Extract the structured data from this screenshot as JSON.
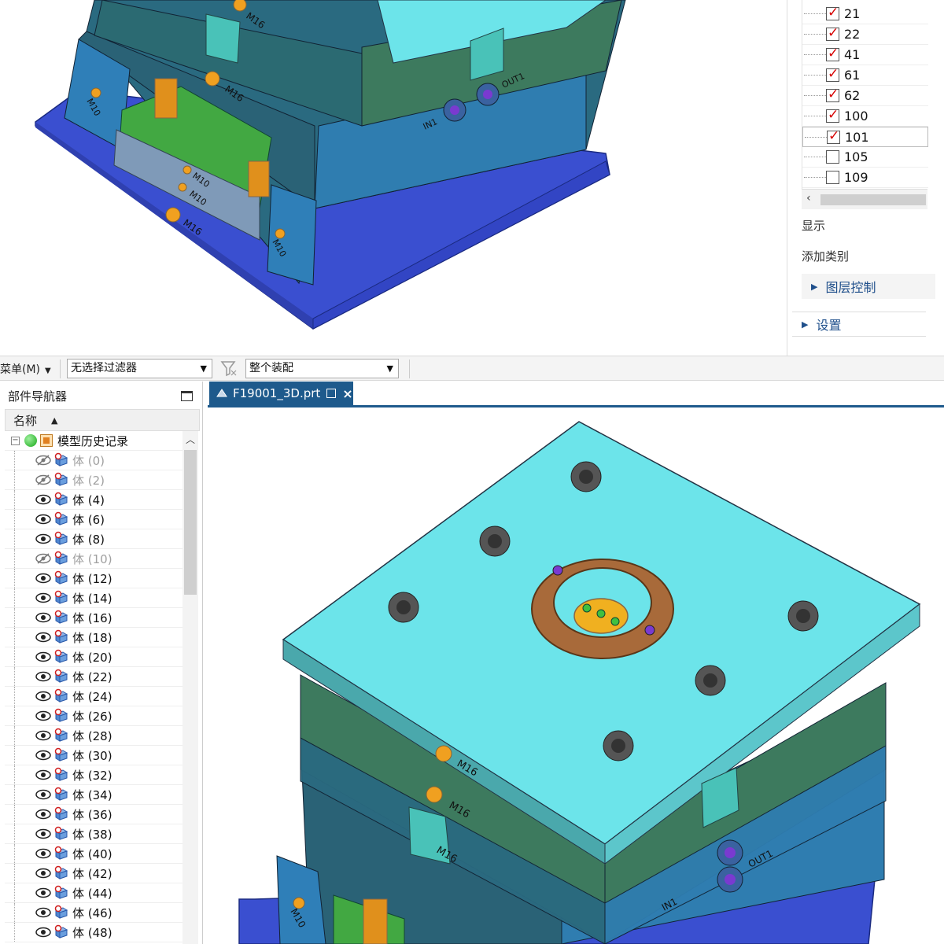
{
  "layer_panel": {
    "layers": [
      {
        "num": "21",
        "checked": true
      },
      {
        "num": "22",
        "checked": true
      },
      {
        "num": "41",
        "checked": true
      },
      {
        "num": "61",
        "checked": true
      },
      {
        "num": "62",
        "checked": true
      },
      {
        "num": "100",
        "checked": true
      },
      {
        "num": "101",
        "checked": true
      },
      {
        "num": "105",
        "checked": false
      },
      {
        "num": "109",
        "checked": false
      }
    ],
    "display_label": "显示",
    "add_category_label": "添加类别",
    "layer_control_label": "图层控制",
    "settings_label": "设置"
  },
  "toolbar": {
    "menu_label": "菜单(M)",
    "selection_filter": "无选择过滤器",
    "assembly_scope": "整个装配"
  },
  "navigator": {
    "title": "部件导航器",
    "column_name": "名称",
    "root_label": "模型历史记录",
    "items": [
      {
        "label": "体 (0)",
        "hidden": true
      },
      {
        "label": "体 (2)",
        "hidden": true
      },
      {
        "label": "体 (4)",
        "hidden": false
      },
      {
        "label": "体 (6)",
        "hidden": false
      },
      {
        "label": "体 (8)",
        "hidden": false
      },
      {
        "label": "体 (10)",
        "hidden": true
      },
      {
        "label": "体 (12)",
        "hidden": false
      },
      {
        "label": "体 (14)",
        "hidden": false
      },
      {
        "label": "体 (16)",
        "hidden": false
      },
      {
        "label": "体 (18)",
        "hidden": false
      },
      {
        "label": "体 (20)",
        "hidden": false
      },
      {
        "label": "体 (22)",
        "hidden": false
      },
      {
        "label": "体 (24)",
        "hidden": false
      },
      {
        "label": "体 (26)",
        "hidden": false
      },
      {
        "label": "体 (28)",
        "hidden": false
      },
      {
        "label": "体 (30)",
        "hidden": false
      },
      {
        "label": "体 (32)",
        "hidden": false
      },
      {
        "label": "体 (34)",
        "hidden": false
      },
      {
        "label": "体 (36)",
        "hidden": false
      },
      {
        "label": "体 (38)",
        "hidden": false
      },
      {
        "label": "体 (40)",
        "hidden": false
      },
      {
        "label": "体 (42)",
        "hidden": false
      },
      {
        "label": "体 (44)",
        "hidden": false
      },
      {
        "label": "体 (46)",
        "hidden": false
      },
      {
        "label": "体 (48)",
        "hidden": false
      }
    ]
  },
  "main_window": {
    "tab_title": "F19001_3D.prt"
  },
  "model_labels": {
    "m16": "M16",
    "m10": "M10",
    "in1": "IN1",
    "out1": "OUT1"
  },
  "colors": {
    "top_plate": "#6ce4ea",
    "a_plate": "#3d7a5e",
    "b_plate": "#2a6a80",
    "spacer": "#2f7fb8",
    "base_plate": "#3a4fd0",
    "locating_ring": "#a86a3a",
    "accent_tab": "#1e5a8c"
  }
}
